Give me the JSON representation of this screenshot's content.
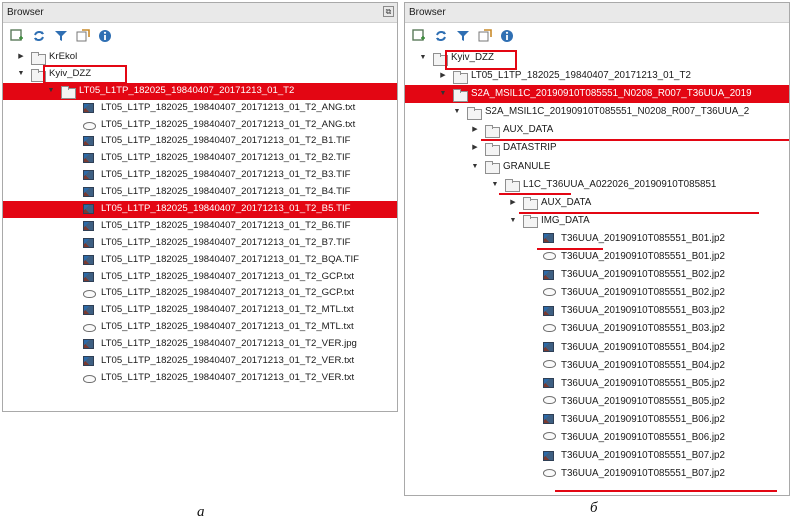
{
  "panel_a": {
    "title": "Browser",
    "rows": [
      {
        "label": "KrEkol",
        "type": "folder",
        "arrow": "▶"
      },
      {
        "label": "Kyiv_DZZ",
        "type": "folder",
        "arrow": "▼"
      },
      {
        "label": "LT05_L1TP_182025_19840407_20171213_01_T2",
        "type": "folder",
        "arrow": "▼"
      },
      {
        "label": "LT05_L1TP_182025_19840407_20171213_01_T2_ANG.txt",
        "type": "raster"
      },
      {
        "label": "LT05_L1TP_182025_19840407_20171213_01_T2_ANG.txt",
        "type": "vector"
      },
      {
        "label": "LT05_L1TP_182025_19840407_20171213_01_T2_B1.TIF",
        "type": "raster"
      },
      {
        "label": "LT05_L1TP_182025_19840407_20171213_01_T2_B2.TIF",
        "type": "raster"
      },
      {
        "label": "LT05_L1TP_182025_19840407_20171213_01_T2_B3.TIF",
        "type": "raster"
      },
      {
        "label": "LT05_L1TP_182025_19840407_20171213_01_T2_B4.TIF",
        "type": "raster"
      },
      {
        "label": "LT05_L1TP_182025_19840407_20171213_01_T2_B5.TIF",
        "type": "raster"
      },
      {
        "label": "LT05_L1TP_182025_19840407_20171213_01_T2_B6.TIF",
        "type": "raster"
      },
      {
        "label": "LT05_L1TP_182025_19840407_20171213_01_T2_B7.TIF",
        "type": "raster"
      },
      {
        "label": "LT05_L1TP_182025_19840407_20171213_01_T2_BQA.TIF",
        "type": "raster"
      },
      {
        "label": "LT05_L1TP_182025_19840407_20171213_01_T2_GCP.txt",
        "type": "raster"
      },
      {
        "label": "LT05_L1TP_182025_19840407_20171213_01_T2_GCP.txt",
        "type": "vector"
      },
      {
        "label": "LT05_L1TP_182025_19840407_20171213_01_T2_MTL.txt",
        "type": "raster"
      },
      {
        "label": "LT05_L1TP_182025_19840407_20171213_01_T2_MTL.txt",
        "type": "vector"
      },
      {
        "label": "LT05_L1TP_182025_19840407_20171213_01_T2_VER.jpg",
        "type": "raster"
      },
      {
        "label": "LT05_L1TP_182025_19840407_20171213_01_T2_VER.txt",
        "type": "raster"
      },
      {
        "label": "LT05_L1TP_182025_19840407_20171213_01_T2_VER.txt",
        "type": "vector"
      }
    ]
  },
  "panel_b": {
    "title": "Browser",
    "rows": [
      {
        "label": "Kyiv_DZZ",
        "type": "folder",
        "arrow": "▼"
      },
      {
        "label": "LT05_L1TP_182025_19840407_20171213_01_T2",
        "type": "folder",
        "arrow": "▶"
      },
      {
        "label": "S2A_MSIL1C_20190910T085551_N0208_R007_T36UUA_2019",
        "type": "folder",
        "arrow": "▼"
      },
      {
        "label": "S2A_MSIL1C_20190910T085551_N0208_R007_T36UUA_2",
        "type": "folder",
        "arrow": "▼"
      },
      {
        "label": "AUX_DATA",
        "type": "folder",
        "arrow": "▶"
      },
      {
        "label": "DATASTRIP",
        "type": "folder",
        "arrow": "▶"
      },
      {
        "label": "GRANULE",
        "type": "folder",
        "arrow": "▼"
      },
      {
        "label": "L1C_T36UUA_A022026_20190910T085851",
        "type": "folder",
        "arrow": "▼"
      },
      {
        "label": "AUX_DATA",
        "type": "folder",
        "arrow": "▶"
      },
      {
        "label": "IMG_DATA",
        "type": "folder",
        "arrow": "▼"
      },
      {
        "label": "T36UUA_20190910T085551_B01.jp2",
        "type": "raster"
      },
      {
        "label": "T36UUA_20190910T085551_B01.jp2",
        "type": "vector"
      },
      {
        "label": "T36UUA_20190910T085551_B02.jp2",
        "type": "raster"
      },
      {
        "label": "T36UUA_20190910T085551_B02.jp2",
        "type": "vector"
      },
      {
        "label": "T36UUA_20190910T085551_B03.jp2",
        "type": "raster"
      },
      {
        "label": "T36UUA_20190910T085551_B03.jp2",
        "type": "vector"
      },
      {
        "label": "T36UUA_20190910T085551_B04.jp2",
        "type": "raster"
      },
      {
        "label": "T36UUA_20190910T085551_B04.jp2",
        "type": "vector"
      },
      {
        "label": "T36UUA_20190910T085551_B05.jp2",
        "type": "raster"
      },
      {
        "label": "T36UUA_20190910T085551_B05.jp2",
        "type": "vector"
      },
      {
        "label": "T36UUA_20190910T085551_B06.jp2",
        "type": "raster"
      },
      {
        "label": "T36UUA_20190910T085551_B06.jp2",
        "type": "vector"
      },
      {
        "label": "T36UUA_20190910T085551_B07.jp2",
        "type": "raster"
      },
      {
        "label": "T36UUA_20190910T085551_B07.jp2",
        "type": "vector"
      }
    ]
  },
  "captions": {
    "a": "a",
    "b": "б"
  },
  "colors": {
    "selection": "#0078d7",
    "highlight_red": "#e30613"
  }
}
